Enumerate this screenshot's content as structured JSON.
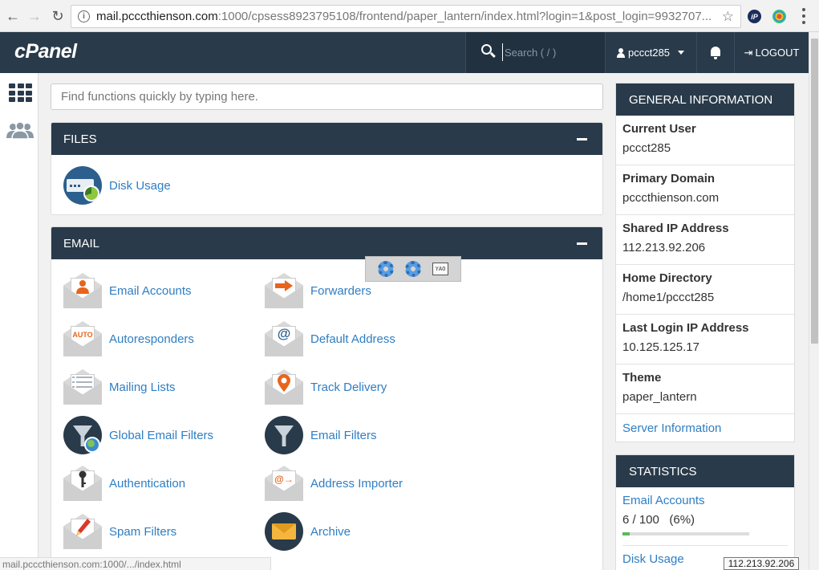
{
  "browser": {
    "url_host": "mail.pcccthienson.com",
    "url_rest": ":1000/cpsess8923795108/frontend/paper_lantern/index.html?login=1&post_login=9932707...",
    "ext1_label": "iP",
    "status_url": "mail.pcccthienson.com:1000/.../index.html"
  },
  "header": {
    "logo": "cPanel",
    "search_placeholder": "Search ( / )",
    "username": "pccct285",
    "logout_label": "LOGOUT"
  },
  "quick_search": {
    "placeholder": "Find functions quickly by typing here."
  },
  "files": {
    "title": "FILES",
    "items": [
      {
        "label": "Disk Usage",
        "icon": "disk-usage-icon"
      }
    ]
  },
  "email": {
    "title": "EMAIL",
    "items": [
      {
        "label": "Email Accounts",
        "icon": "email-accounts-icon"
      },
      {
        "label": "Forwarders",
        "icon": "forwarders-icon"
      },
      {
        "label": "Autoresponders",
        "icon": "autoresponders-icon",
        "glyph": "AUTO"
      },
      {
        "label": "Default Address",
        "icon": "default-address-icon",
        "glyph": "@"
      },
      {
        "label": "Mailing Lists",
        "icon": "mailing-lists-icon"
      },
      {
        "label": "Track Delivery",
        "icon": "track-delivery-icon"
      },
      {
        "label": "Global Email Filters",
        "icon": "global-email-filters-icon"
      },
      {
        "label": "Email Filters",
        "icon": "email-filters-icon"
      },
      {
        "label": "Authentication",
        "icon": "authentication-icon"
      },
      {
        "label": "Address Importer",
        "icon": "address-importer-icon",
        "glyph": "@→"
      },
      {
        "label": "Spam Filters",
        "icon": "spam-filters-icon"
      },
      {
        "label": "Archive",
        "icon": "archive-icon"
      }
    ]
  },
  "float_toolbar": {
    "kbd_label": "YAO"
  },
  "general_info": {
    "title": "GENERAL INFORMATION",
    "rows": [
      {
        "label": "Current User",
        "value": "pccct285"
      },
      {
        "label": "Primary Domain",
        "value": "pcccthienson.com"
      },
      {
        "label": "Shared IP Address",
        "value": "112.213.92.206"
      },
      {
        "label": "Home Directory",
        "value": "/home1/pccct285"
      },
      {
        "label": "Last Login IP Address",
        "value": "10.125.125.17"
      },
      {
        "label": "Theme",
        "value": "paper_lantern"
      }
    ],
    "server_info_link": "Server Information"
  },
  "statistics": {
    "title": "STATISTICS",
    "email_accounts_label": "Email Accounts",
    "email_accounts_value": "6 / 100   (6%)",
    "email_accounts_fraction": 0.06,
    "disk_usage_label": "Disk Usage"
  },
  "tooltip": "112.213.92.206",
  "colors": {
    "header_bg": "#293a4a",
    "link": "#2e7ec4",
    "progress": "#5cb85c"
  }
}
